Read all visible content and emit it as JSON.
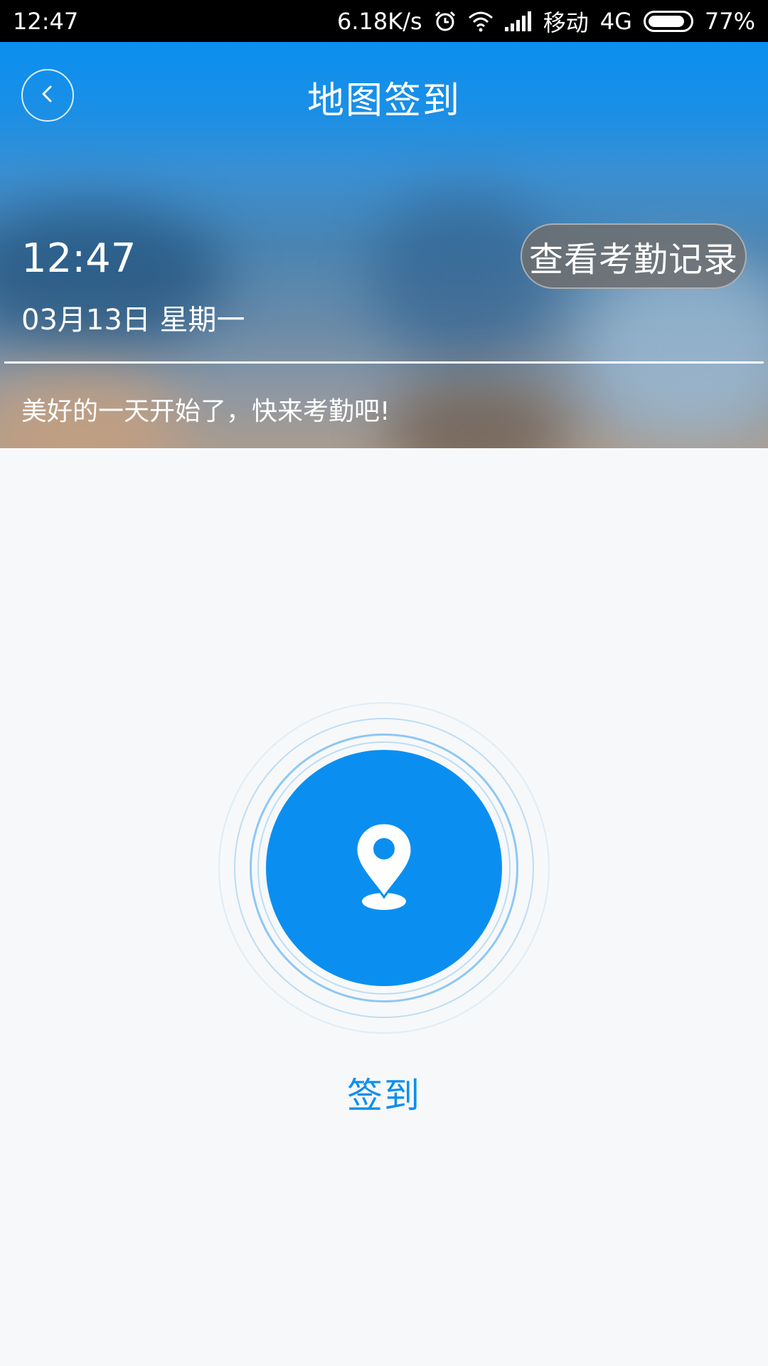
{
  "status_bar": {
    "time": "12:47",
    "net_speed": "6.18K/s",
    "carrier": "移动",
    "network": "4G",
    "battery": "77%",
    "icons": [
      "alarm-icon",
      "wifi-icon",
      "signal-icon",
      "battery-icon"
    ]
  },
  "header": {
    "title": "地图签到",
    "time": "12:47",
    "date": "03月13日 星期一",
    "record_button_label": "查看考勤记录",
    "motto": "美好的一天开始了，快来考勤吧!"
  },
  "checkin": {
    "label": "签到",
    "icon": "location-pin-icon"
  },
  "colors": {
    "accent": "#0a8ff0",
    "background": "#f7f8f9"
  }
}
